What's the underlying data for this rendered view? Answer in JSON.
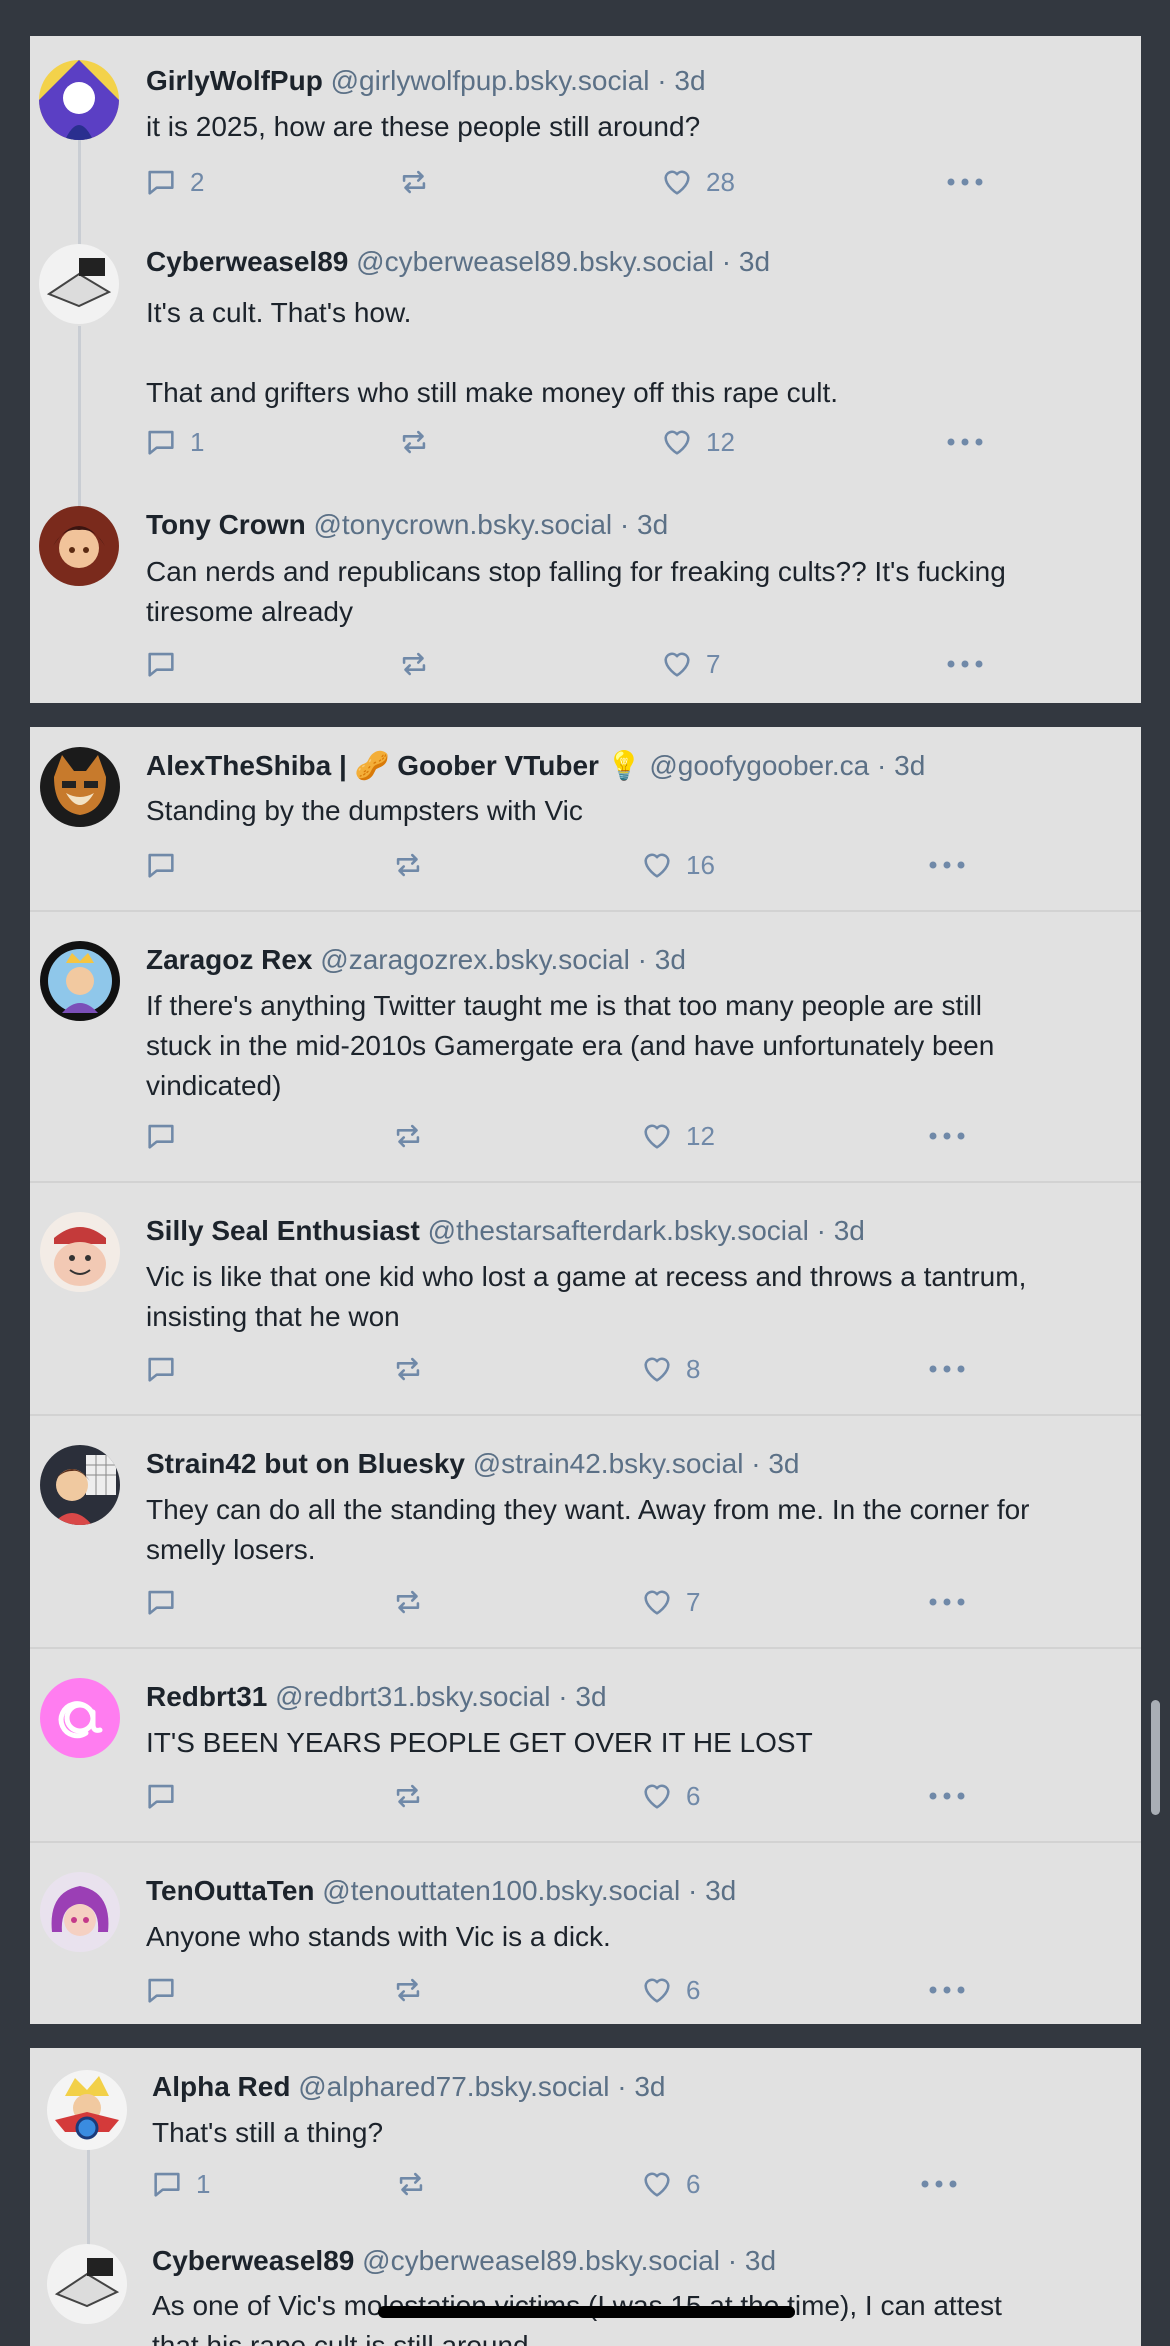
{
  "threads": [
    {
      "posts": [
        {
          "name": "GirlyWolfPup",
          "handle": "@girlywolfpup.bsky.social",
          "age": "3d",
          "text": [
            "it is 2025, how are these people still around?"
          ],
          "replies": "2",
          "reposts": "",
          "likes": "28",
          "avatar": "avatar-girlywolfpup"
        },
        {
          "name": "Cyberweasel89",
          "handle": "@cyberweasel89.bsky.social",
          "age": "3d",
          "text": [
            "It's a cult. That's how.",
            "",
            "That and grifters who still make money off this rape cult."
          ],
          "replies": "1",
          "reposts": "",
          "likes": "12",
          "avatar": "avatar-cyberweasel89"
        },
        {
          "name": "Tony Crown",
          "handle": "@tonycrown.bsky.social",
          "age": "3d",
          "text": [
            "Can nerds and republicans stop falling for freaking cults?? It's fucking",
            "tiresome already"
          ],
          "replies": "",
          "reposts": "",
          "likes": "7",
          "avatar": "avatar-tonycrown"
        }
      ]
    },
    {
      "posts": [
        {
          "name": "AlexTheShiba | 🥜 Goober VTuber 💡",
          "handle": "@goofygoober.ca",
          "age": "3d",
          "text": [
            "Standing by the dumpsters with Vic"
          ],
          "replies": "",
          "reposts": "",
          "likes": "16",
          "avatar": "avatar-alextheshiba"
        },
        {
          "name": "Zaragoz Rex",
          "handle": "@zaragozrex.bsky.social",
          "age": "3d",
          "text": [
            "If there's anything Twitter taught me is that too many people are still",
            "stuck in the mid-2010s Gamergate era (and have unfortunately been",
            "vindicated)"
          ],
          "replies": "",
          "reposts": "",
          "likes": "12",
          "avatar": "avatar-zaragozrex"
        },
        {
          "name": "Silly Seal Enthusiast",
          "handle": "@thestarsafterdark.bsky.social",
          "age": "3d",
          "text": [
            "Vic is like that one kid who lost a game at recess and throws a tantrum,",
            "insisting that he won"
          ],
          "replies": "",
          "reposts": "",
          "likes": "8",
          "avatar": "avatar-sillyseal"
        },
        {
          "name": "Strain42 but on Bluesky",
          "handle": "@strain42.bsky.social",
          "age": "3d",
          "text": [
            "They can do all the standing they want. Away from me. In the corner for",
            "smelly losers."
          ],
          "replies": "",
          "reposts": "",
          "likes": "7",
          "avatar": "avatar-strain42"
        },
        {
          "name": "Redbrt31",
          "handle": "@redbrt31.bsky.social",
          "age": "3d",
          "text": [
            "IT'S BEEN YEARS PEOPLE GET OVER IT HE LOST"
          ],
          "replies": "",
          "reposts": "",
          "likes": "6",
          "avatar": "avatar-redbrt31"
        },
        {
          "name": "TenOuttaTen",
          "handle": "@tenouttaten100.bsky.social",
          "age": "3d",
          "text": [
            "Anyone who stands with Vic is a dick."
          ],
          "replies": "",
          "reposts": "",
          "likes": "6",
          "avatar": "avatar-tenouttaten"
        }
      ]
    },
    {
      "posts": [
        {
          "name": "Alpha Red",
          "handle": "@alphared77.bsky.social",
          "age": "3d",
          "text": [
            "That's still a thing?"
          ],
          "replies": "1",
          "reposts": "",
          "likes": "6",
          "avatar": "avatar-alphared"
        },
        {
          "name": "Cyberweasel89",
          "handle": "@cyberweasel89.bsky.social",
          "age": "3d",
          "text": [
            "As one of Vic's molestation victims (I was 15 at the time), I can attest",
            "that his rape cult is still around."
          ],
          "replies": "",
          "reposts": "",
          "likes": "",
          "avatar": "avatar-cyberweasel89"
        }
      ]
    }
  ],
  "separator": " · ",
  "colors": {
    "background": "#333840",
    "card": "#e1e1e1",
    "text": "#1c232b",
    "muted": "#5b7086",
    "action": "#7089a8"
  },
  "icons": {
    "reply": "reply-icon",
    "repost": "repost-icon",
    "like": "heart-icon",
    "more": "more-options-icon"
  }
}
